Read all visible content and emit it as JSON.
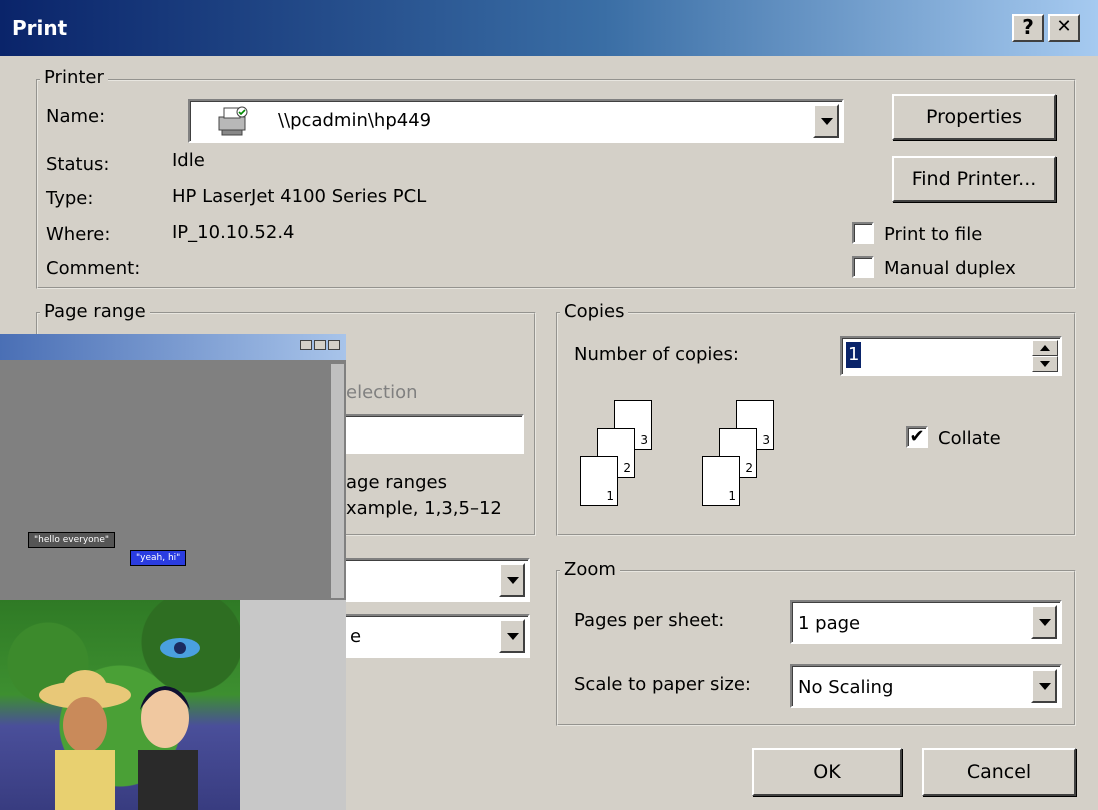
{
  "window": {
    "title": "Print",
    "help_btn": "?",
    "close_btn": "✕"
  },
  "printer": {
    "group_label": "Printer",
    "name_label": "Name:",
    "name_value": "\\\\pcadmin\\hp449",
    "status_label": "Status:",
    "status_value": "Idle",
    "type_label": "Type:",
    "type_value": "HP LaserJet 4100 Series PCL",
    "where_label": "Where:",
    "where_value": "IP_10.10.52.4",
    "comment_label": "Comment:",
    "properties_btn": "Properties",
    "find_printer_btn": "Find Printer...",
    "print_to_file": "Print to file",
    "manual_duplex": "Manual duplex"
  },
  "page_range": {
    "group_label": "Page range",
    "selection_label": "election",
    "hint_line1": "age ranges",
    "hint_line2": "xample, 1,3,5–12"
  },
  "print_what": {
    "value1": "",
    "value2": "e"
  },
  "copies": {
    "group_label": "Copies",
    "number_label": "Number of copies:",
    "number_value": "1",
    "collate_label": "Collate",
    "collate_checked": "✔",
    "page_nums": [
      "1",
      "2",
      "3"
    ]
  },
  "zoom": {
    "group_label": "Zoom",
    "pages_per_sheet_label": "Pages per sheet:",
    "pages_per_sheet_value": "1 page",
    "scale_label": "Scale to paper size:",
    "scale_value": "No Scaling"
  },
  "buttons": {
    "ok": "OK",
    "cancel": "Cancel"
  },
  "overlay": {
    "bubble1": "\"hello everyone\"",
    "bubble2": "\"yeah, hi\""
  }
}
